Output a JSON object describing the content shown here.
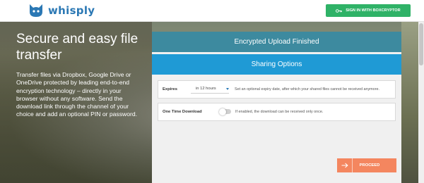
{
  "header": {
    "logo_text": "whisply",
    "signin_label": "SIGN IN WITH BOXCRYPTOR"
  },
  "hero": {
    "title": "Secure and easy file transfer",
    "description": "Transfer files via Dropbox, Google Drive or OneDrive protected by leading end-to-end encryption technology – directly in your browser without any software. Send the download link through the channel of your choice and add an optional PIN or password."
  },
  "panel": {
    "finished_title": "Encrypted Upload Finished",
    "sharing_title": "Sharing Options",
    "expires": {
      "label": "Expires",
      "value": "in 12 hours",
      "description": "Set an optional expiry date, after which your shared files cannot be received anymore."
    },
    "one_time": {
      "label": "One Time Download",
      "enabled": false,
      "description": "If enabled, the download can be received only once."
    },
    "proceed_label": "PROCEED"
  },
  "colors": {
    "brand_blue": "#2b78b4",
    "signin_green": "#2fb267",
    "finished_bar": "#3d8a9f",
    "sharing_bar": "#1f9ad5",
    "proceed_orange": "#f4865f"
  },
  "icons": {
    "logo": "cat-head-icon",
    "signin": "key-icon",
    "select": "caret-down-icon",
    "proceed": "arrow-right-icon"
  }
}
